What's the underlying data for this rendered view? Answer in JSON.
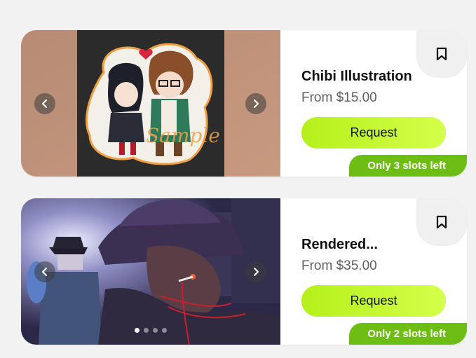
{
  "listings": [
    {
      "title": "Chibi Illustration",
      "price": "From $15.00",
      "request_label": "Request",
      "slots_text": "Only 3 slots left",
      "watermark": "Sample"
    },
    {
      "title": "Rendered...",
      "price": "From $35.00",
      "request_label": "Request",
      "slots_text": "Only 2 slots left",
      "carousel_dots": 4,
      "active_dot": 1
    }
  ],
  "icons": {
    "prev": "chevron-left-icon",
    "next": "chevron-right-icon",
    "bookmark": "bookmark-icon"
  },
  "colors": {
    "request_button": "#c7f53a",
    "slots_badge": "#6dbd15",
    "bookmark_tab": "#f0f0f0"
  }
}
